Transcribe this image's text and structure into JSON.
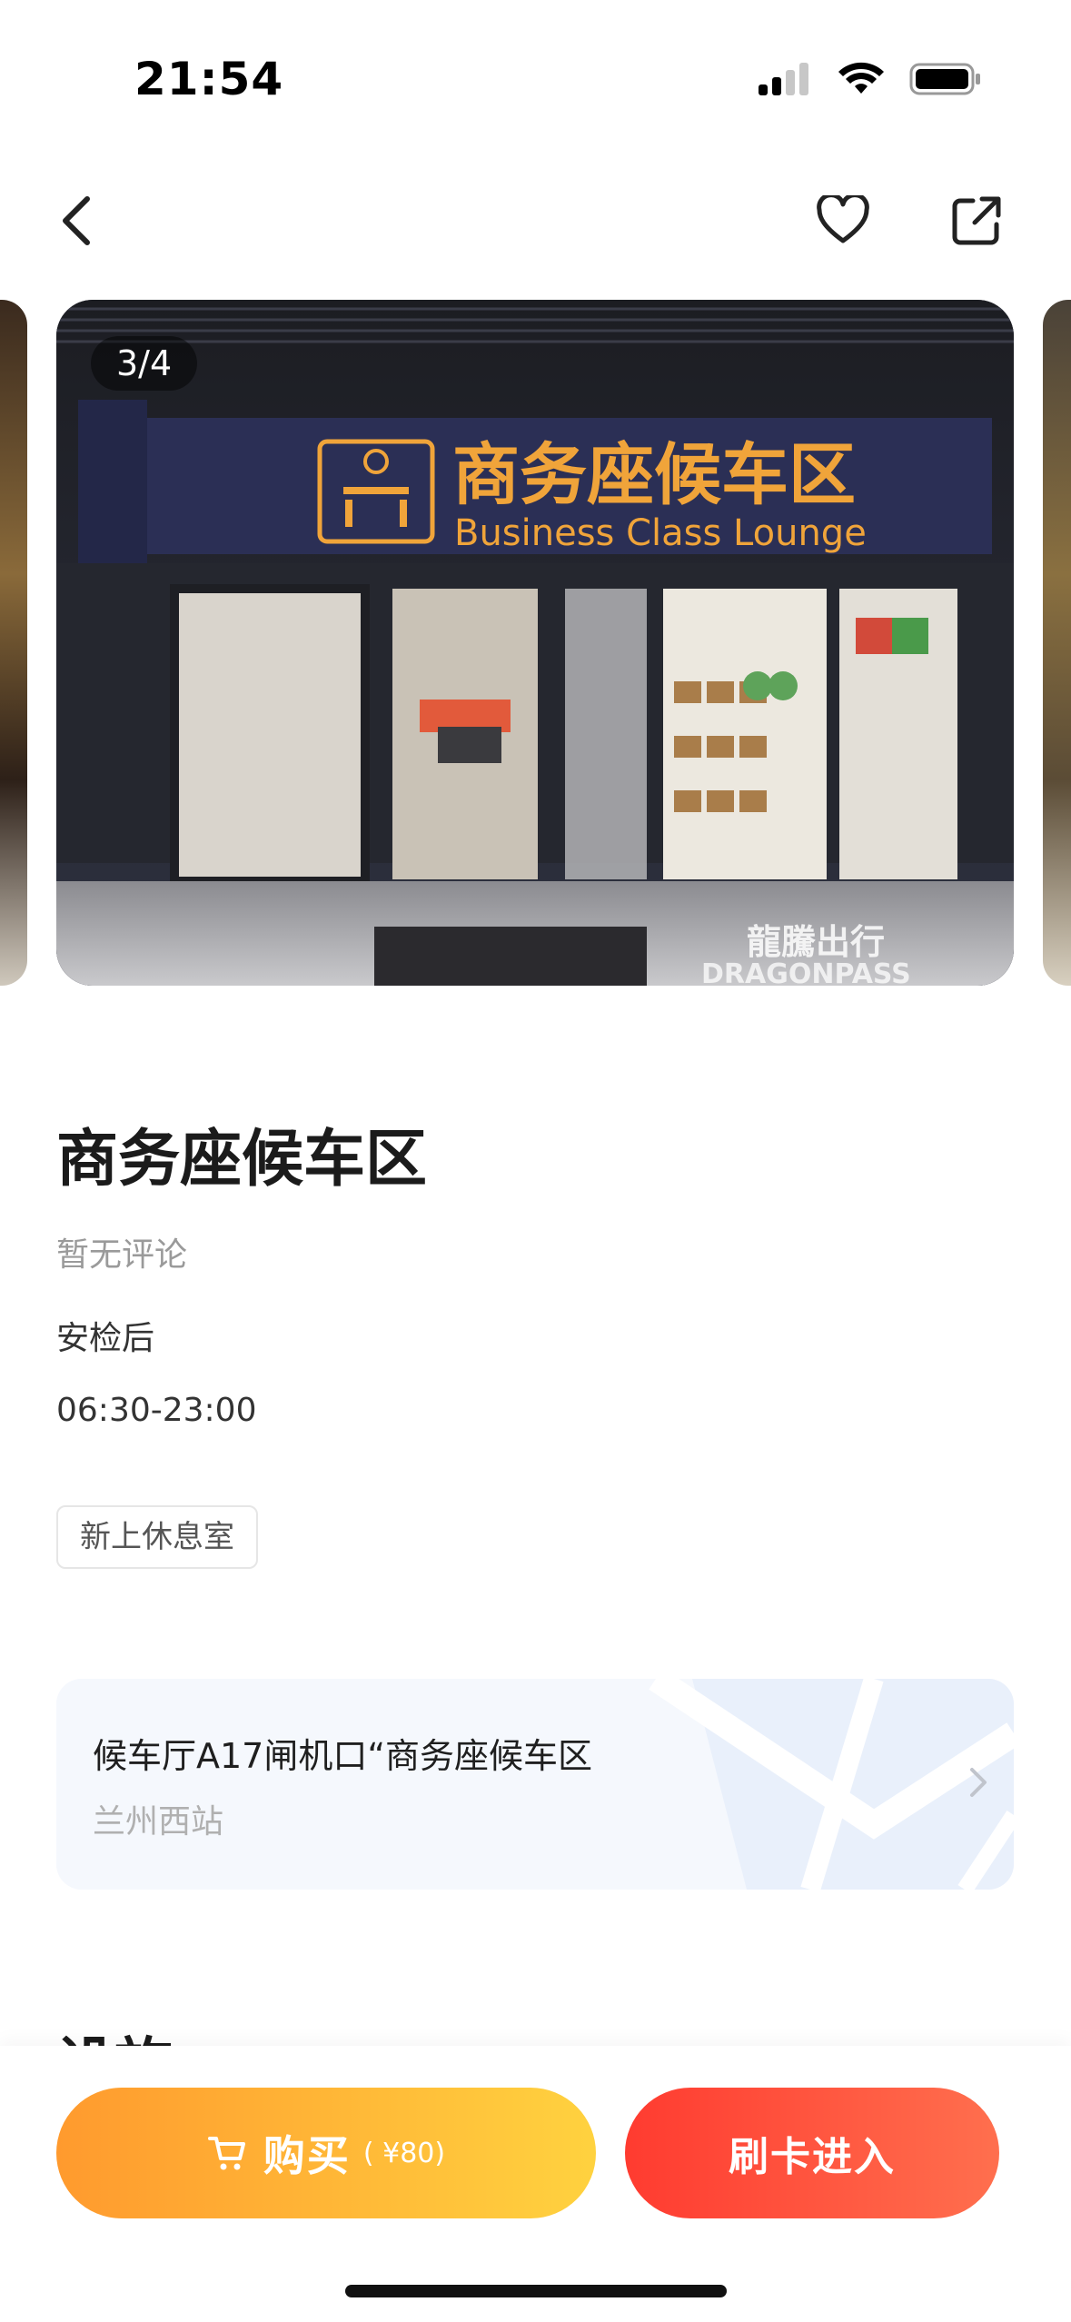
{
  "status_bar": {
    "time": "21:54"
  },
  "gallery": {
    "counter": "3/4",
    "sign_cn": "商务座候车区",
    "sign_en": "Business Class Lounge",
    "watermark_cn": "龍騰出行",
    "watermark_en": "DRAGONPASS"
  },
  "lounge": {
    "name": "商务座候车区",
    "rating_text": "暂无评论",
    "location_type": "安检后",
    "hours": "06:30-23:00",
    "tag": "新上休息室"
  },
  "location_card": {
    "title": "候车厅A17闸机口“商务座候车区",
    "station": "兰州西站"
  },
  "section": {
    "facilities": "设施"
  },
  "actions": {
    "buy_label": "购买",
    "buy_price": "( ¥80)",
    "enter_label": "刷卡进入"
  },
  "colors": {
    "buy_gradient": [
      "#ff9a2e",
      "#ffd23f"
    ],
    "enter_gradient": [
      "#ff3b30",
      "#ff6f4e"
    ]
  }
}
